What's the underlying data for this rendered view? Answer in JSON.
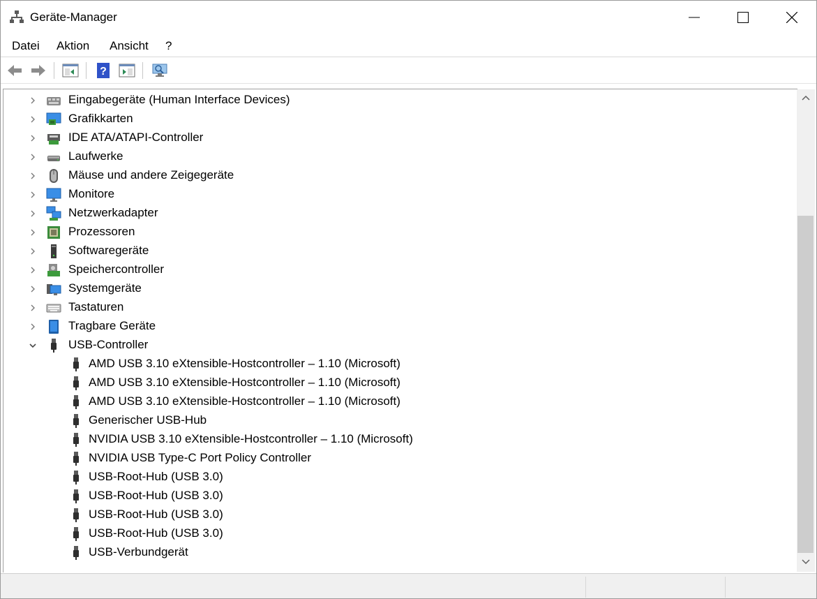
{
  "window": {
    "title": "Geräte-Manager",
    "icon": "device-manager-icon"
  },
  "menu": [
    "Datei",
    "Aktion",
    "Ansicht",
    "?"
  ],
  "toolbar": {
    "buttons": [
      "back-arrow-icon",
      "forward-arrow-icon",
      "properties-icon",
      "help-icon",
      "console-view-icon",
      "scan-hardware-icon"
    ]
  },
  "tree": {
    "categories": [
      {
        "label": "Eingabegeräte (Human Interface Devices)",
        "icon": "hid-icon",
        "expanded": false
      },
      {
        "label": "Grafikkarten",
        "icon": "display-adapter-icon",
        "expanded": false
      },
      {
        "label": "IDE ATA/ATAPI-Controller",
        "icon": "ide-controller-icon",
        "expanded": false
      },
      {
        "label": "Laufwerke",
        "icon": "disk-drive-icon",
        "expanded": false
      },
      {
        "label": "Mäuse und andere Zeigegeräte",
        "icon": "mouse-icon",
        "expanded": false
      },
      {
        "label": "Monitore",
        "icon": "monitor-icon",
        "expanded": false
      },
      {
        "label": "Netzwerkadapter",
        "icon": "network-adapter-icon",
        "expanded": false
      },
      {
        "label": "Prozessoren",
        "icon": "processor-icon",
        "expanded": false
      },
      {
        "label": "Softwaregeräte",
        "icon": "software-device-icon",
        "expanded": false
      },
      {
        "label": "Speichercontroller",
        "icon": "storage-controller-icon",
        "expanded": false
      },
      {
        "label": "Systemgeräte",
        "icon": "system-device-icon",
        "expanded": false
      },
      {
        "label": "Tastaturen",
        "icon": "keyboard-icon",
        "expanded": false
      },
      {
        "label": "Tragbare Geräte",
        "icon": "portable-device-icon",
        "expanded": false
      },
      {
        "label": "USB-Controller",
        "icon": "usb-plug-icon",
        "expanded": true
      }
    ],
    "usb_children": [
      "AMD USB 3.10 eXtensible-Hostcontroller – 1.10 (Microsoft)",
      "AMD USB 3.10 eXtensible-Hostcontroller – 1.10 (Microsoft)",
      "AMD USB 3.10 eXtensible-Hostcontroller – 1.10 (Microsoft)",
      "Generischer USB-Hub",
      "NVIDIA USB 3.10 eXtensible-Hostcontroller – 1.10 (Microsoft)",
      "NVIDIA USB Type-C Port Policy Controller",
      "USB-Root-Hub (USB 3.0)",
      "USB-Root-Hub (USB 3.0)",
      "USB-Root-Hub (USB 3.0)",
      "USB-Root-Hub (USB 3.0)",
      "USB-Verbundgerät"
    ]
  },
  "colors": {
    "accent": "#0078d7",
    "scroll_thumb": "#cdcdcd"
  }
}
